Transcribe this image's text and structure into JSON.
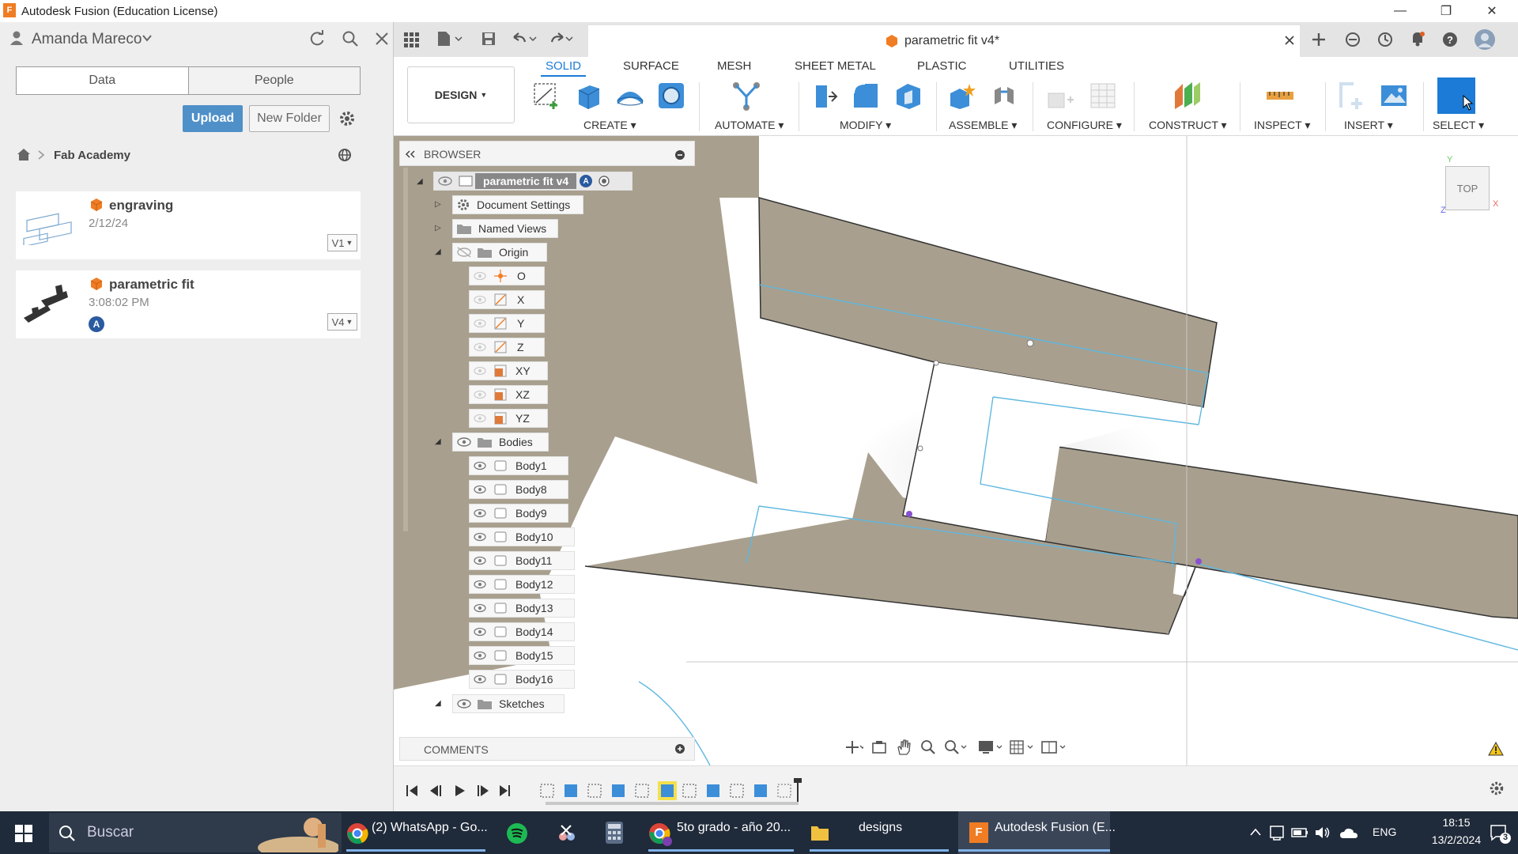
{
  "window": {
    "title": "Autodesk Fusion (Education License)"
  },
  "data_panel": {
    "user_name": "Amanda Mareco",
    "tabs": [
      "Data",
      "People"
    ],
    "upload_label": "Upload",
    "new_folder_label": "New Folder",
    "breadcrumb": "Fab Academy",
    "items": [
      {
        "name": "engraving",
        "date": "2/12/24",
        "version": "V1"
      },
      {
        "name": "parametric fit",
        "date": "3:08:02 PM",
        "version": "V4",
        "badge": "A"
      }
    ]
  },
  "document": {
    "title": "parametric fit v4*"
  },
  "ribbon": {
    "workspace": "DESIGN",
    "tabs": [
      "SOLID",
      "SURFACE",
      "MESH",
      "SHEET METAL",
      "PLASTIC",
      "UTILITIES"
    ],
    "active_tab": "SOLID",
    "groups": [
      "CREATE",
      "AUTOMATE",
      "MODIFY",
      "ASSEMBLE",
      "CONFIGURE",
      "CONSTRUCT",
      "INSPECT",
      "INSERT",
      "SELECT"
    ]
  },
  "browser": {
    "title": "BROWSER",
    "root": "parametric fit v4",
    "root_badge": "A",
    "document_settings": "Document Settings",
    "named_views": "Named Views",
    "origin": "Origin",
    "origin_items": [
      "O",
      "X",
      "Y",
      "Z",
      "XY",
      "XZ",
      "YZ"
    ],
    "bodies_folder": "Bodies",
    "bodies": [
      "Body1",
      "Body8",
      "Body9",
      "Body10",
      "Body11",
      "Body12",
      "Body13",
      "Body14",
      "Body15",
      "Body16"
    ],
    "sketches": "Sketches",
    "comments": "COMMENTS"
  },
  "viewcube": {
    "face": "TOP",
    "axis_x": "X",
    "axis_y": "Y",
    "axis_z": "Z"
  },
  "taskbar": {
    "search_placeholder": "Buscar",
    "items": [
      {
        "label": "(2) WhatsApp - Go..."
      },
      {
        "label": "5to grado - año 20..."
      },
      {
        "label": "designs"
      },
      {
        "label": "Autodesk Fusion (E..."
      }
    ],
    "language": "ENG",
    "time": "18:15",
    "date": "13/2/2024",
    "notifications": "3"
  },
  "colors": {
    "accent": "#1c7bd6",
    "upload": "#4f90c8",
    "body_fill": "#a89f8e",
    "sketch_line": "#5fb8e0",
    "fusion_orange": "#f07d23",
    "taskbar": "#1f2a3a"
  }
}
